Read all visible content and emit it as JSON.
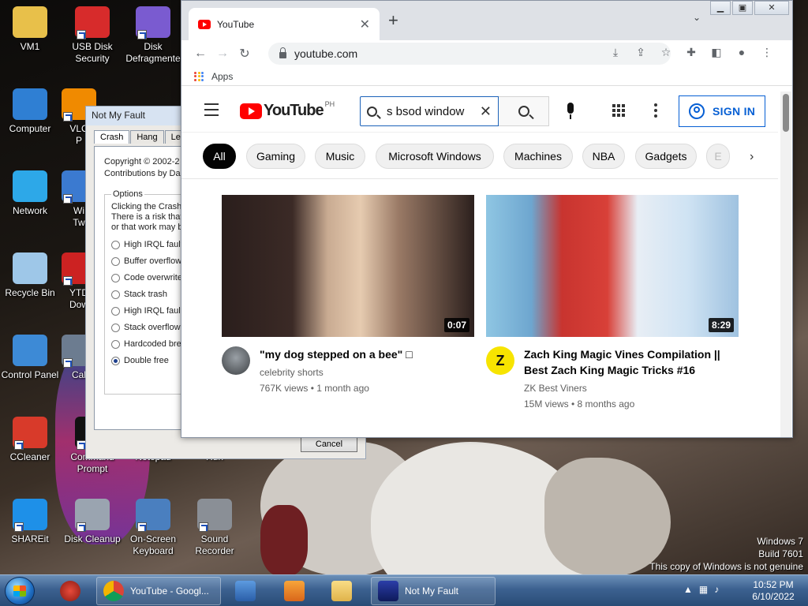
{
  "desktop": {
    "icons": [
      {
        "label1": "VM1",
        "label2": "",
        "icon": "folder-user-icon",
        "color": "#e8c04a"
      },
      {
        "label1": "USB Disk",
        "label2": "Security",
        "icon": "usb-shield-icon",
        "color": "#d72b2b"
      },
      {
        "label1": "Disk",
        "label2": "Defragmente",
        "icon": "defrag-icon",
        "color": "#7a5bd0"
      },
      {
        "label1": "Computer",
        "label2": "",
        "icon": "computer-icon",
        "color": "#2f7fd3"
      },
      {
        "label1": "VLC",
        "label2": "P",
        "icon": "vlc-icon",
        "color": "#f08a00"
      },
      {
        "label1": "Network",
        "label2": "",
        "icon": "network-icon",
        "color": "#2da8e8"
      },
      {
        "label1": "Wi",
        "label2": "Tw",
        "icon": "window-icon",
        "color": "#3b7ad0"
      },
      {
        "label1": "Recycle Bin",
        "label2": "",
        "icon": "recycle-bin-icon",
        "color": "#9ec7e8"
      },
      {
        "label1": "YTD",
        "label2": "Dow",
        "icon": "ytd-icon",
        "color": "#c22"
      },
      {
        "label1": "Control Panel",
        "label2": "",
        "icon": "control-panel-icon",
        "color": "#3d8ad6"
      },
      {
        "label1": "Cal",
        "label2": "",
        "icon": "calculator-icon",
        "color": "#6c7c90"
      },
      {
        "label1": "CCleaner",
        "label2": "",
        "icon": "ccleaner-icon",
        "color": "#d83a2a"
      },
      {
        "label1": "Command",
        "label2": "Prompt",
        "icon": "command-prompt-icon",
        "color": "#111"
      },
      {
        "label1": "Notepad",
        "label2": "",
        "icon": "notepad-icon",
        "color": "#6fa8dc"
      },
      {
        "label1": "Run",
        "label2": "",
        "icon": "run-icon",
        "color": "#6fa8dc"
      },
      {
        "label1": "SHAREit",
        "label2": "",
        "icon": "shareit-icon",
        "color": "#1e90e8"
      },
      {
        "label1": "Disk Cleanup",
        "label2": "",
        "icon": "disk-cleanup-icon",
        "color": "#9aa4b0"
      },
      {
        "label1": "On-Screen",
        "label2": "Keyboard",
        "icon": "keyboard-icon",
        "color": "#4a7fbf"
      },
      {
        "label1": "Sound",
        "label2": "Recorder",
        "icon": "microphone-icon",
        "color": "#8a8f96"
      }
    ],
    "watermark": [
      "Windows 7",
      "Build 7601",
      "This copy of Windows is not genuine"
    ]
  },
  "notmyfault": {
    "title": "Not My Fault",
    "tabs": [
      "Crash",
      "Hang",
      "Leak"
    ],
    "copyright1": "Copyright © 2002-2",
    "copyright2": "Contributions by Da",
    "options_legend": "Options",
    "desc1": "Clicking the Crash",
    "desc2": "There is a risk that",
    "desc3": "or that work may b",
    "options": [
      "High IRQL fault",
      "Buffer overflow",
      "Code overwrite",
      "Stack trash",
      "High IRQL fault",
      "Stack overflow",
      "Hardcoded bre",
      "Double free"
    ],
    "selected_index": 7,
    "cancel": "Cancel"
  },
  "chrome": {
    "tab_title": "YouTube",
    "url": "youtube.com",
    "bookmark_apps": "Apps"
  },
  "youtube": {
    "logo_text": "YouTube",
    "region": "PH",
    "search_query": "s bsod window",
    "sign_in": "SIGN IN",
    "chips": [
      "All",
      "Gaming",
      "Music",
      "Microsoft Windows",
      "Machines",
      "NBA",
      "Gadgets",
      "E"
    ],
    "videos": [
      {
        "title": "\"my dog stepped on a bee\" □",
        "title2": "",
        "channel": "celebrity shorts",
        "views": "767K views • 1 month ago",
        "duration": "0:07"
      },
      {
        "title": "Zach King Magic Vines Compilation ||",
        "title2": "Best Zach King Magic Tricks #16",
        "channel": "ZK Best Viners",
        "views": "15M views • 8 months ago",
        "duration": "8:29"
      }
    ]
  },
  "taskbar": {
    "chrome_item": "YouTube - Googl...",
    "nmf_item": "Not My Fault",
    "time": "10:52 PM",
    "date": "6/10/2022"
  }
}
